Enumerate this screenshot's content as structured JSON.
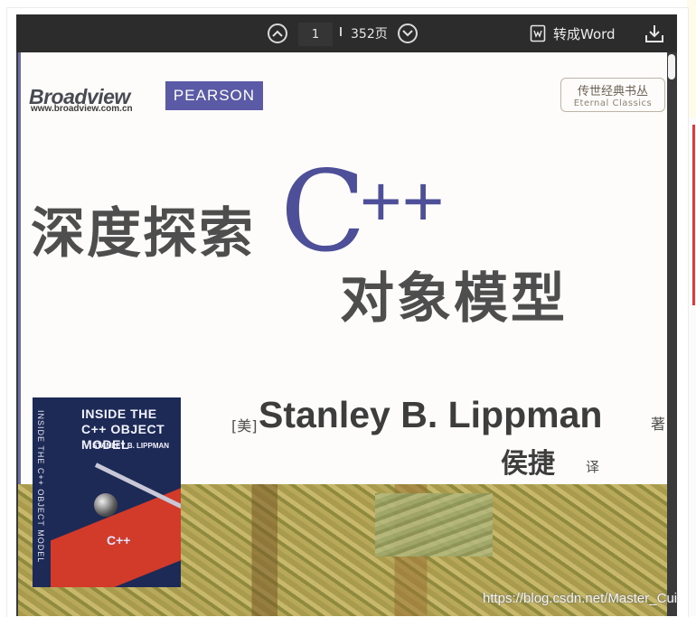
{
  "toolbar": {
    "prev_page_icon": "chevron-up-circle-icon",
    "current_page": "1",
    "total_pages": "352页",
    "next_page_icon": "chevron-down-circle-icon",
    "convert_label": "转成Word",
    "convert_icon": "word-doc-icon",
    "download_icon": "download-icon"
  },
  "book": {
    "publisher_brand": "Broadview",
    "publisher_url": "www.broadview.com.cn",
    "publisher_partner": "PEARSON",
    "series_cn": "传世经典书丛",
    "series_en": "Eternal Classics",
    "title_cn": "深度探索",
    "title_lang_c": "C",
    "title_lang_pp": "++",
    "subtitle_cn": "对象模型",
    "author_prefix": "[美]",
    "author": "Stanley B. Lippman",
    "author_suffix": "著",
    "translator": "侯捷",
    "translator_suffix": "译",
    "cover_title": "INSIDE THE C++ OBJECT MODEL",
    "cover_author": "STANLEY B. LIPPMAN",
    "cover_spine": "INSIDE THE C++ OBJECT MODEL",
    "cover_cpp": "C++"
  },
  "watermark": "https://blog.csdn.net/Master_Cui",
  "colors": {
    "toolbar_bg": "#2c2c2c",
    "accent_purple": "#4d4f98",
    "pearson_bg": "#5a5aa6"
  }
}
